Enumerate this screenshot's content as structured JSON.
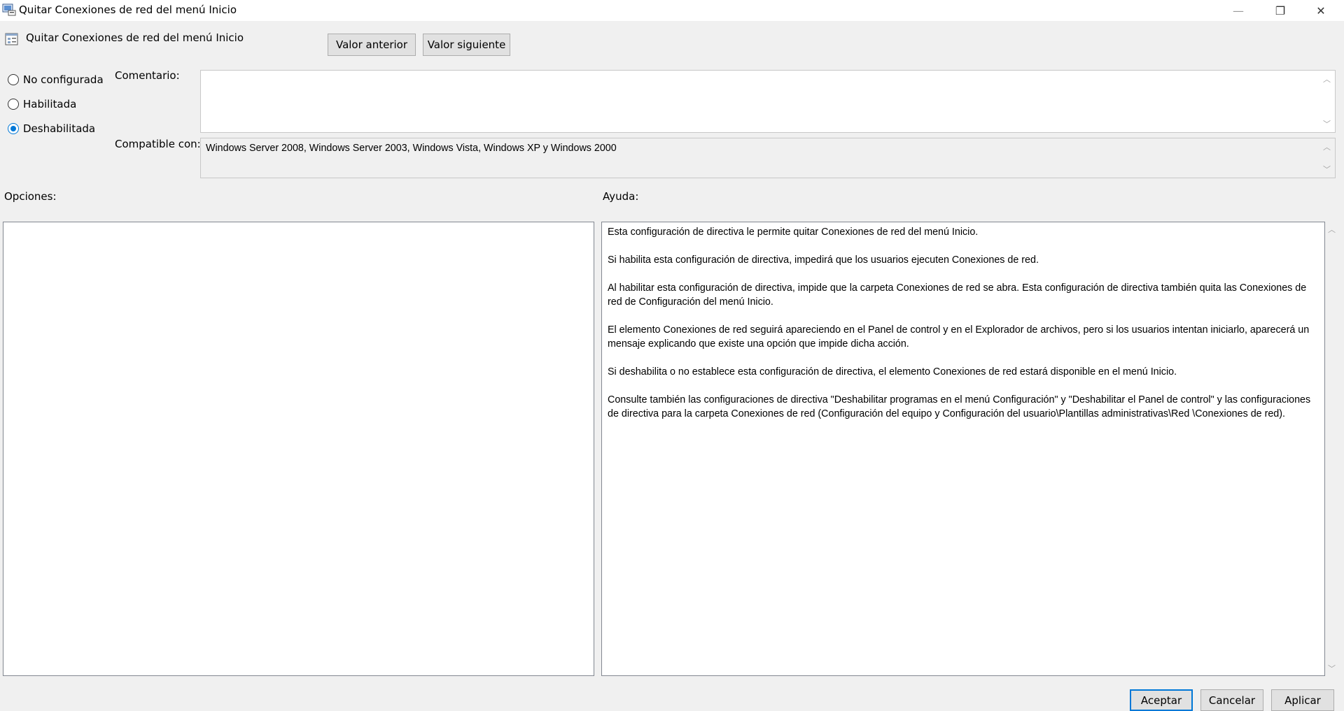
{
  "window": {
    "title": "Quitar Conexiones de red del menú Inicio",
    "minimize_glyph": "—",
    "restore_glyph": "❐",
    "close_glyph": "✕"
  },
  "header": {
    "policy_name": "Quitar Conexiones de red del menú Inicio",
    "prev_button": "Valor anterior",
    "next_button": "Valor siguiente"
  },
  "state": {
    "options": [
      {
        "label": "No configurada",
        "checked": false
      },
      {
        "label": "Habilitada",
        "checked": false
      },
      {
        "label": "Deshabilitada",
        "checked": true
      }
    ]
  },
  "comment": {
    "label": "Comentario:",
    "value": ""
  },
  "supported": {
    "label": "Compatible con:",
    "value": "Windows Server 2008, Windows Server 2003, Windows Vista, Windows XP y Windows 2000"
  },
  "options_section": {
    "label": "Opciones:"
  },
  "help_section": {
    "label": "Ayuda:",
    "paragraphs": [
      "Esta configuración de directiva le permite quitar Conexiones de red del menú Inicio.",
      "Si habilita esta configuración de directiva, impedirá que los usuarios ejecuten Conexiones de red.",
      "Al habilitar esta configuración de directiva, impide que la carpeta Conexiones de red se abra. Esta configuración de directiva también quita las Conexiones de red de Configuración del menú Inicio.",
      "El elemento Conexiones de red seguirá apareciendo en el Panel de control y en el Explorador de archivos, pero si los usuarios intentan iniciarlo, aparecerá un mensaje explicando que existe una opción que impide dicha acción.",
      "Si deshabilita o no establece esta configuración de directiva, el elemento Conexiones de red estará disponible en el menú Inicio.",
      "Consulte también las configuraciones de directiva \"Deshabilitar programas en el menú Configuración\" y \"Deshabilitar el Panel de control\" y las configuraciones de directiva para la carpeta Conexiones de red (Configuración del equipo y Configuración del usuario\\Plantillas administrativas\\Red \\Conexiones de red)."
    ]
  },
  "footer": {
    "ok": "Aceptar",
    "cancel": "Cancelar",
    "apply": "Aplicar"
  }
}
